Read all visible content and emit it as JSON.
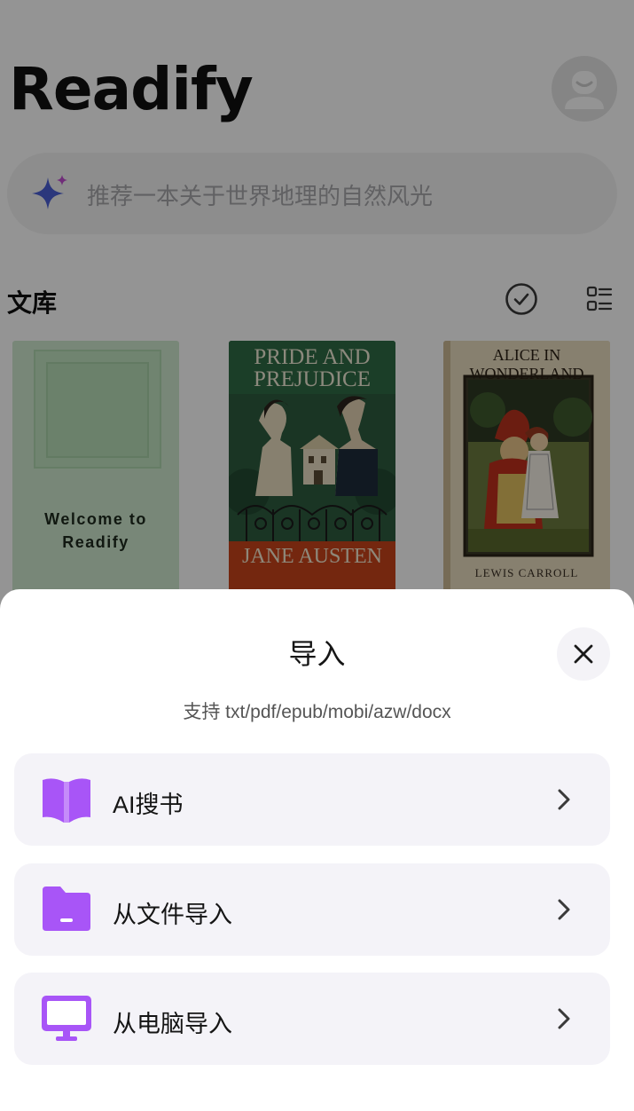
{
  "app": {
    "title": "Readify"
  },
  "search": {
    "placeholder": "推荐一本关于世界地理的自然风光"
  },
  "library": {
    "title": "文库",
    "books": [
      {
        "cover_text": "Welcome to\nReadify"
      },
      {
        "title": "PRIDE AND\nPREJUDICE",
        "author": "JANE AUSTEN"
      },
      {
        "title": "ALICE IN WONDERLAND",
        "author": "LEWIS CARROLL"
      }
    ]
  },
  "import_sheet": {
    "title": "导入",
    "subtitle": "支持 txt/pdf/epub/mobi/azw/docx",
    "options": [
      {
        "label": "AI搜书",
        "icon": "book-icon"
      },
      {
        "label": "从文件导入",
        "icon": "folder-icon"
      },
      {
        "label": "从电脑导入",
        "icon": "monitor-icon"
      }
    ]
  },
  "colors": {
    "accent": "#a855f7",
    "overlay": "#6b6b6b"
  }
}
